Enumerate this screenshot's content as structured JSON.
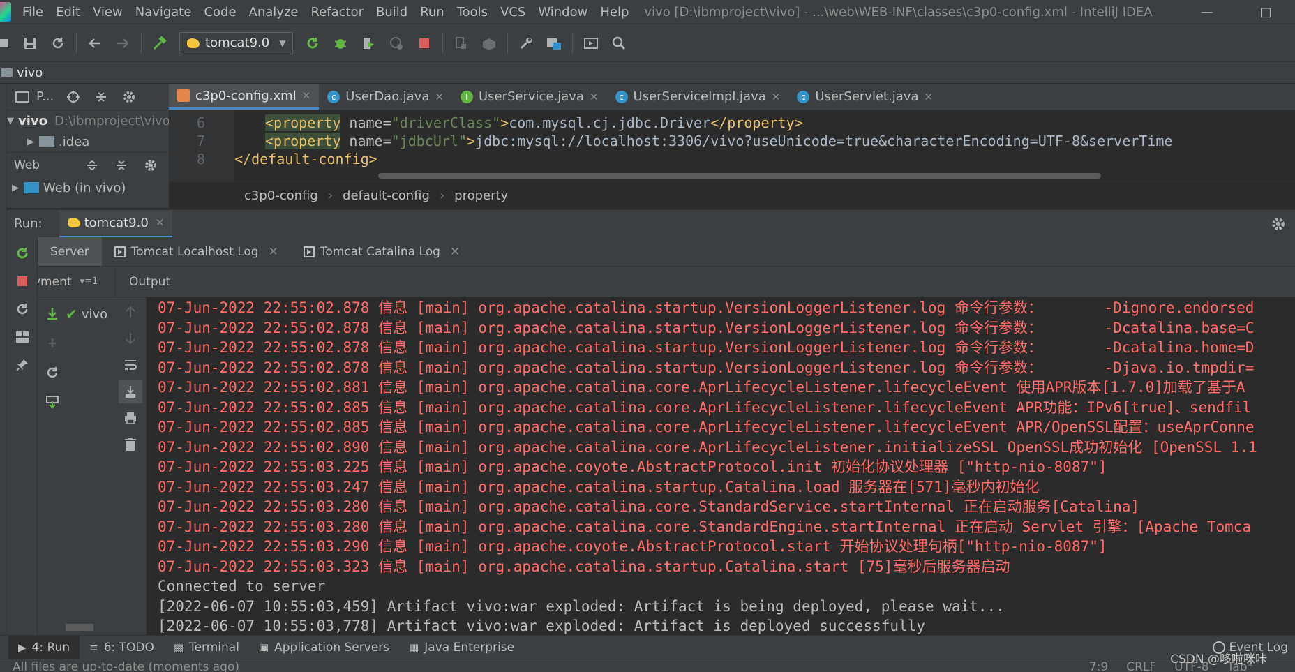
{
  "menubar": {
    "items": [
      "File",
      "Edit",
      "View",
      "Navigate",
      "Code",
      "Analyze",
      "Refactor",
      "Build",
      "Run",
      "Tools",
      "VCS",
      "Window",
      "Help"
    ],
    "title": "vivo [D:\\ibmproject\\vivo] - ...\\web\\WEB-INF\\classes\\c3p0-config.xml - IntelliJ IDEA"
  },
  "toolbar": {
    "run_config": "tomcat9.0"
  },
  "navbar": {
    "project": "vivo"
  },
  "project_panel": {
    "header_label": "P...",
    "root_name": "vivo",
    "root_path": "D:\\ibmproject\\vivo",
    "child": ".idea",
    "web_header": "Web",
    "web_item": "Web (in vivo)"
  },
  "editor": {
    "tabs": [
      {
        "label": "c3p0-config.xml",
        "icon": "xml-file-icon"
      },
      {
        "label": "UserDao.java",
        "icon": "class-icon"
      },
      {
        "label": "UserService.java",
        "icon": "interface-icon"
      },
      {
        "label": "UserServiceImpl.java",
        "icon": "class-icon"
      },
      {
        "label": "UserServlet.java",
        "icon": "class-icon"
      }
    ],
    "lines": [
      {
        "no": "6",
        "tag_open": "<property",
        "attr": " name=",
        "val": "\"driverClass\"",
        "close": ">",
        "text": "com.mysql.cj.jdbc.Driver",
        "end": "</property>"
      },
      {
        "no": "7",
        "tag_open": "<property",
        "attr": " name=",
        "val": "\"jdbcUrl\"",
        "close": ">",
        "text": "jdbc:mysql://localhost:3306/vivo?useUnicode=true&characterEncoding=UTF-8&serverTime",
        "end": ""
      },
      {
        "no": "8",
        "tag_open": "</default-config>",
        "attr": "",
        "val": "",
        "close": "",
        "text": "",
        "end": ""
      }
    ],
    "breadcrumb": [
      "c3p0-config",
      "default-config",
      "property"
    ]
  },
  "run": {
    "label": "Run:",
    "tab": "tomcat9.0",
    "server_tabs": [
      "Server",
      "Tomcat Localhost Log",
      "Tomcat Catalina Log"
    ],
    "deployment_label": "yment",
    "deployment_item": "vivo",
    "output_label": "Output",
    "console_lines": [
      {
        "type": "err",
        "text": "07-Jun-2022 22:55:02.878 信息 [main] org.apache.catalina.startup.VersionLoggerListener.log 命令行参数：       -Dignore.endorsed"
      },
      {
        "type": "err",
        "text": "07-Jun-2022 22:55:02.878 信息 [main] org.apache.catalina.startup.VersionLoggerListener.log 命令行参数：       -Dcatalina.base=C"
      },
      {
        "type": "err",
        "text": "07-Jun-2022 22:55:02.878 信息 [main] org.apache.catalina.startup.VersionLoggerListener.log 命令行参数：       -Dcatalina.home=D"
      },
      {
        "type": "err",
        "text": "07-Jun-2022 22:55:02.878 信息 [main] org.apache.catalina.startup.VersionLoggerListener.log 命令行参数：       -Djava.io.tmpdir="
      },
      {
        "type": "err",
        "text": "07-Jun-2022 22:55:02.881 信息 [main] org.apache.catalina.core.AprLifecycleListener.lifecycleEvent 使用APR版本[1.7.0]加载了基于A"
      },
      {
        "type": "err",
        "text": "07-Jun-2022 22:55:02.885 信息 [main] org.apache.catalina.core.AprLifecycleListener.lifecycleEvent APR功能：IPv6[true]、sendfil"
      },
      {
        "type": "err",
        "text": "07-Jun-2022 22:55:02.885 信息 [main] org.apache.catalina.core.AprLifecycleListener.lifecycleEvent APR/OpenSSL配置：useAprConne"
      },
      {
        "type": "err",
        "text": "07-Jun-2022 22:55:02.890 信息 [main] org.apache.catalina.core.AprLifecycleListener.initializeSSL OpenSSL成功初始化 [OpenSSL 1.1"
      },
      {
        "type": "err",
        "text": "07-Jun-2022 22:55:03.225 信息 [main] org.apache.coyote.AbstractProtocol.init 初始化协议处理器 [\"http-nio-8087\"]"
      },
      {
        "type": "err",
        "text": "07-Jun-2022 22:55:03.247 信息 [main] org.apache.catalina.startup.Catalina.load 服务器在[571]毫秒内初始化"
      },
      {
        "type": "err",
        "text": "07-Jun-2022 22:55:03.280 信息 [main] org.apache.catalina.core.StandardService.startInternal 正在启动服务[Catalina]"
      },
      {
        "type": "err",
        "text": "07-Jun-2022 22:55:03.280 信息 [main] org.apache.catalina.core.StandardEngine.startInternal 正在启动 Servlet 引擎：[Apache Tomca"
      },
      {
        "type": "err",
        "text": "07-Jun-2022 22:55:03.290 信息 [main] org.apache.coyote.AbstractProtocol.start 开始协议处理句柄[\"http-nio-8087\"]"
      },
      {
        "type": "err",
        "text": "07-Jun-2022 22:55:03.323 信息 [main] org.apache.catalina.startup.Catalina.start [75]毫秒后服务器启动"
      },
      {
        "type": "out",
        "text": "Connected to server"
      },
      {
        "type": "out",
        "text": "[2022-06-07 10:55:03,459] Artifact vivo:war exploded: Artifact is being deployed, please wait..."
      },
      {
        "type": "out",
        "text": "[2022-06-07 10:55:03,778] Artifact vivo:war exploded: Artifact is deployed successfully"
      }
    ]
  },
  "bottom_tabs": [
    {
      "key": "4",
      "label": ": Run",
      "icon": "run-icon"
    },
    {
      "key": "6",
      "label": ": TODO",
      "icon": "todo-icon"
    },
    {
      "key": "",
      "label": "Terminal",
      "icon": "terminal-icon"
    },
    {
      "key": "",
      "label": "Application Servers",
      "icon": "app-servers-icon"
    },
    {
      "key": "",
      "label": "Java Enterprise",
      "icon": "java-enterprise-icon"
    }
  ],
  "event_log": "Event Log",
  "status": {
    "message": "All files are up-to-date (moments ago)",
    "position": "7:9",
    "line_sep": "CRLF",
    "encoding": "UTF-8",
    "indent": "Tab*"
  },
  "watermark": "CSDN @哆啦咪咔"
}
